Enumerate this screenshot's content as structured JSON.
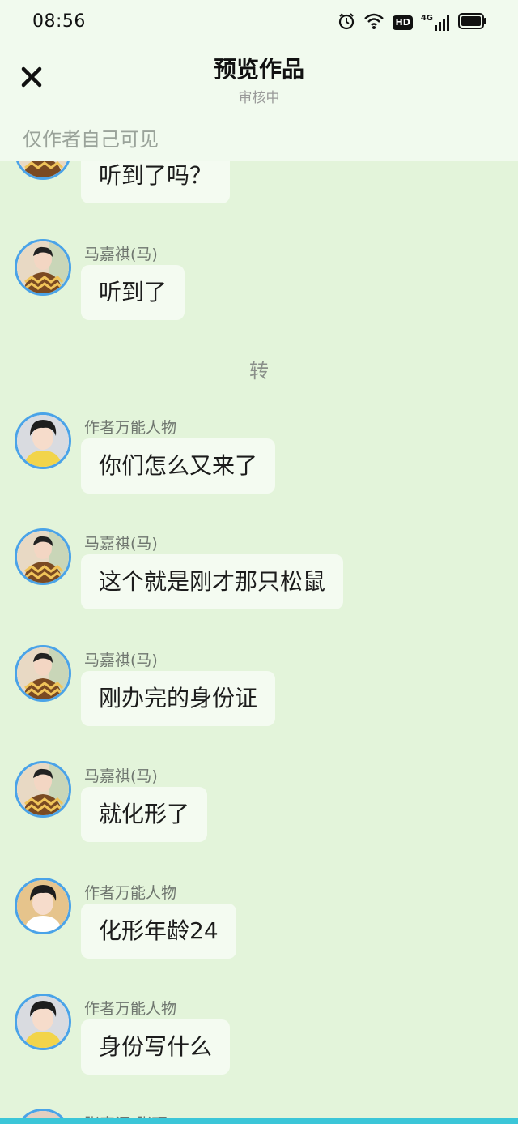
{
  "status": {
    "time": "08:56",
    "icons": [
      "alarm-icon",
      "wifi-icon",
      "hd-icon",
      "signal-4g-icon",
      "battery-icon"
    ],
    "hd_label": "HD",
    "net_label": "4G"
  },
  "header": {
    "title": "预览作品",
    "subtitle": "审核中",
    "visibility_note": "仅作者自己可见"
  },
  "divider": "转",
  "messages": [
    {
      "avatar": "avatar-mjq",
      "name": "",
      "text": "听到了吗？"
    },
    {
      "avatar": "avatar-mjq",
      "name": "马嘉祺(马)",
      "text": "听到了"
    },
    {
      "avatar": "avatar-author",
      "name": "作者万能人物",
      "text": "你们怎么又来了"
    },
    {
      "avatar": "avatar-mjq",
      "name": "马嘉祺(马)",
      "text": "这个就是刚才那只松鼠"
    },
    {
      "avatar": "avatar-mjq",
      "name": "马嘉祺(马)",
      "text": "刚办完的身份证"
    },
    {
      "avatar": "avatar-mjq",
      "name": "马嘉祺(马)",
      "text": "就化形了"
    },
    {
      "avatar": "avatar-author",
      "name": "作者万能人物",
      "text": "化形年龄24"
    },
    {
      "avatar": "avatar-author",
      "name": "作者万能人物",
      "text": "身份写什么"
    },
    {
      "avatar": "avatar-other",
      "name": "张真源(张顶)",
      "text": ""
    }
  ],
  "colors": {
    "background": "#e3f4da",
    "header_bg": "#f1faee",
    "bubble": "#f4fbf1",
    "avatar_ring": "#4aa3e8",
    "bottom_strip": "#3bc6d8"
  }
}
